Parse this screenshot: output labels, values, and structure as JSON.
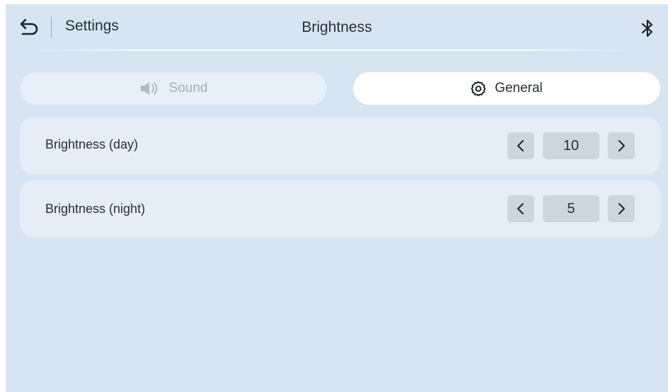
{
  "header": {
    "back_label": "Settings",
    "title": "Brightness",
    "back_icon": "back-arrow-icon",
    "right_icon": "bluetooth-icon"
  },
  "tabs": [
    {
      "label": "Sound",
      "icon": "speaker-icon",
      "active": false
    },
    {
      "label": "General",
      "icon": "gear-icon",
      "active": true
    }
  ],
  "settings": [
    {
      "label": "Brightness (day)",
      "value": "10"
    },
    {
      "label": "Brightness (night)",
      "value": "5"
    }
  ],
  "colors": {
    "background": "#d7e5f3",
    "row": "#e5edf6",
    "active_tab": "#ffffff",
    "stepper": "#cdd5de",
    "text": "#2a2f36",
    "muted_text": "#a7b0ba"
  }
}
